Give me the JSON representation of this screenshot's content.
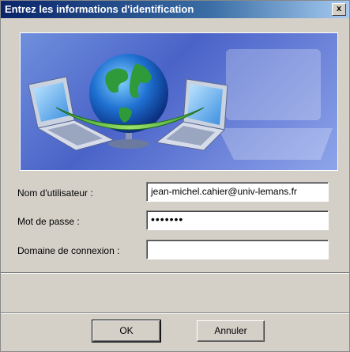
{
  "window": {
    "title": "Entrez les informations d'identification",
    "close_label": "x"
  },
  "form": {
    "username": {
      "label": "Nom d'utilisateur :",
      "value": "jean-michel.cahier@univ-lemans.fr"
    },
    "password": {
      "label": "Mot de passe :",
      "value": "•••••••"
    },
    "domain": {
      "label": "Domaine de connexion :",
      "value": ""
    }
  },
  "buttons": {
    "ok": "OK",
    "cancel": "Annuler"
  }
}
